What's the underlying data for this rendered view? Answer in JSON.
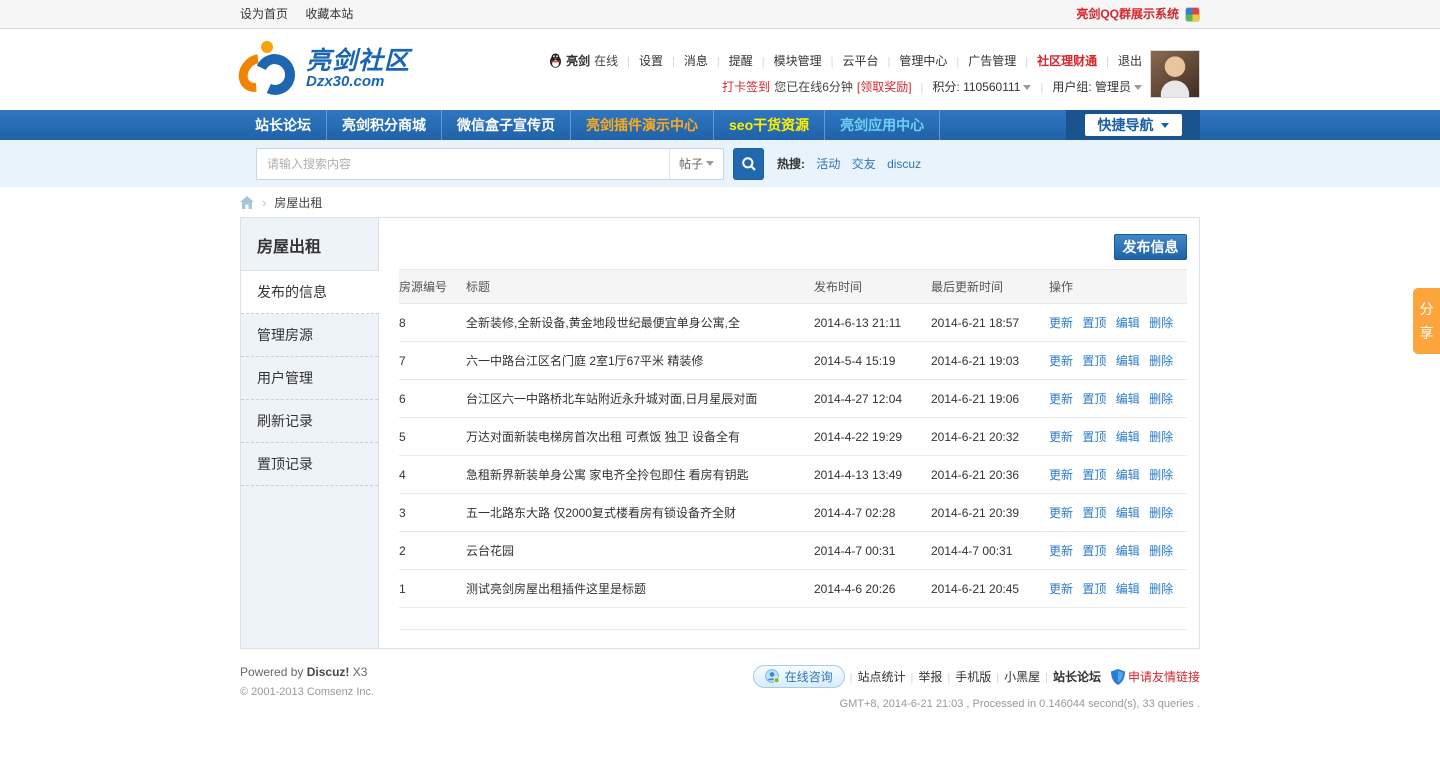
{
  "topbar": {
    "set_home": "设为首页",
    "bookmark": "收藏本站",
    "promo": "亮剑QQ群展示系统"
  },
  "header": {
    "logo_title": "亮剑社区",
    "logo_domain": "Dzx30.com",
    "user_row1": {
      "username": "亮剑",
      "online": "在线",
      "links": [
        "设置",
        "消息",
        "提醒",
        "模块管理",
        "云平台",
        "管理中心",
        "广告管理"
      ],
      "finance": "社区理财通",
      "logout": "退出"
    },
    "user_row2": {
      "checkin": "打卡签到",
      "online_text": "您已在线6分钟",
      "reward": "[领取奖励]",
      "credits_label": "积分: 110560111",
      "group_label": "用户组: 管理员"
    }
  },
  "nav": {
    "items": [
      {
        "label": "站长论坛",
        "color": "#ffffff"
      },
      {
        "label": "亮剑积分商城",
        "color": "#ffffff"
      },
      {
        "label": "微信盒子宣传页",
        "color": "#ffffff"
      },
      {
        "label": "亮剑插件演示中心",
        "color": "#ffaa1d"
      },
      {
        "label": "seo干货资源",
        "color": "#fff000"
      },
      {
        "label": "亮剑应用中心",
        "color": "#6fd0f5"
      }
    ],
    "quick_nav": "快捷导航"
  },
  "search": {
    "placeholder": "请输入搜索内容",
    "type": "帖子",
    "hot_label": "热搜:",
    "hot_links": [
      "活动",
      "交友",
      "discuz"
    ]
  },
  "breadcrumb": {
    "current": "房屋出租"
  },
  "sidebar": {
    "title": "房屋出租",
    "items": [
      {
        "label": "发布的信息"
      },
      {
        "label": "管理房源"
      },
      {
        "label": "用户管理"
      },
      {
        "label": "刷新记录"
      },
      {
        "label": "置顶记录"
      }
    ]
  },
  "main": {
    "publish_button": "发布信息",
    "table": {
      "headers": [
        "房源编号",
        "标题",
        "发布时间",
        "最后更新时间",
        "操作"
      ],
      "actions": [
        "更新",
        "置顶",
        "编辑",
        "删除"
      ],
      "rows": [
        {
          "id": "8",
          "title": "全新装修,全新设备,黄金地段世纪最便宜单身公寓,全",
          "publish": "2014-6-13 21:11",
          "updated": "2014-6-21 18:57"
        },
        {
          "id": "7",
          "title": "六一中路台江区名门庭 2室1厅67平米 精装修",
          "publish": "2014-5-4 15:19",
          "updated": "2014-6-21 19:03"
        },
        {
          "id": "6",
          "title": "台江区六一中路桥北车站附近永升城对面,日月星辰对面",
          "publish": "2014-4-27 12:04",
          "updated": "2014-6-21 19:06"
        },
        {
          "id": "5",
          "title": "万达对面新装电梯房首次出租 可煮饭 独卫 设备全有",
          "publish": "2014-4-22 19:29",
          "updated": "2014-6-21 20:32"
        },
        {
          "id": "4",
          "title": "急租新界新装单身公寓 家电齐全拎包即住 看房有钥匙",
          "publish": "2014-4-13 13:49",
          "updated": "2014-6-21 20:36"
        },
        {
          "id": "3",
          "title": "五一北路东大路 仅2000复式楼看房有锁设备齐全财",
          "publish": "2014-4-7 02:28",
          "updated": "2014-6-21 20:39"
        },
        {
          "id": "2",
          "title": "云台花园",
          "publish": "2014-4-7 00:31",
          "updated": "2014-4-7 00:31"
        },
        {
          "id": "1",
          "title": "测试亮剑房屋出租插件这里是标题",
          "publish": "2014-4-6 20:26",
          "updated": "2014-6-21 20:45"
        }
      ]
    }
  },
  "footer": {
    "powered_prefix": "Powered by",
    "powered_brand": "Discuz!",
    "powered_version": "X3",
    "copyright": "© 2001-2013 Comsenz Inc.",
    "online_service": "在线咨询",
    "links": [
      "站点统计",
      "举报",
      "手机版",
      "小黑屋"
    ],
    "forum_link": "站长论坛",
    "friend_link": "申请友情链接",
    "stats": "GMT+8, 2014-6-21 21:03 , Processed in 0.146044 second(s), 33 queries ."
  },
  "share_tab": "分享",
  "colors": {
    "nav_bg": "#2468b2",
    "accent_blue": "#2b7bc8",
    "highlight_red": "#d4262e",
    "share_orange": "#fba53c",
    "search_bg": "#e9f3fb",
    "sidebar_bg": "#eef3f8"
  }
}
